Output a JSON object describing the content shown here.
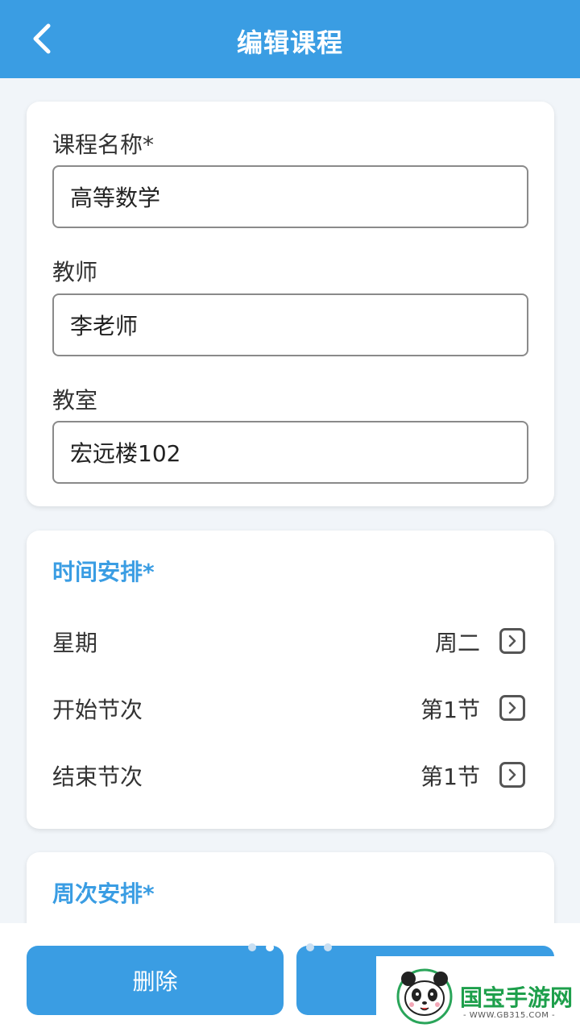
{
  "header": {
    "title": "编辑课程",
    "back_icon": "chevron-left-icon"
  },
  "form": {
    "course_name": {
      "label": "课程名称*",
      "value": "高等数学"
    },
    "teacher": {
      "label": "教师",
      "value": "李老师"
    },
    "classroom": {
      "label": "教室",
      "value": "宏远楼102"
    }
  },
  "schedule": {
    "title": "时间安排*",
    "rows": [
      {
        "label": "星期",
        "value": "周二",
        "icon": "chevron-right-icon"
      },
      {
        "label": "开始节次",
        "value": "第1节",
        "icon": "chevron-right-icon"
      },
      {
        "label": "结束节次",
        "value": "第1节",
        "icon": "chevron-right-icon"
      }
    ]
  },
  "weeks": {
    "title": "周次安排*"
  },
  "footer": {
    "delete_label": "删除",
    "save_label": ""
  },
  "watermark": {
    "text": "国宝手游网",
    "url": "- WWW.GB315.COM -"
  },
  "colors": {
    "primary": "#3a9de3",
    "background": "#f1f5f9",
    "card": "#ffffff",
    "watermark_green": "#1d9f4b"
  }
}
